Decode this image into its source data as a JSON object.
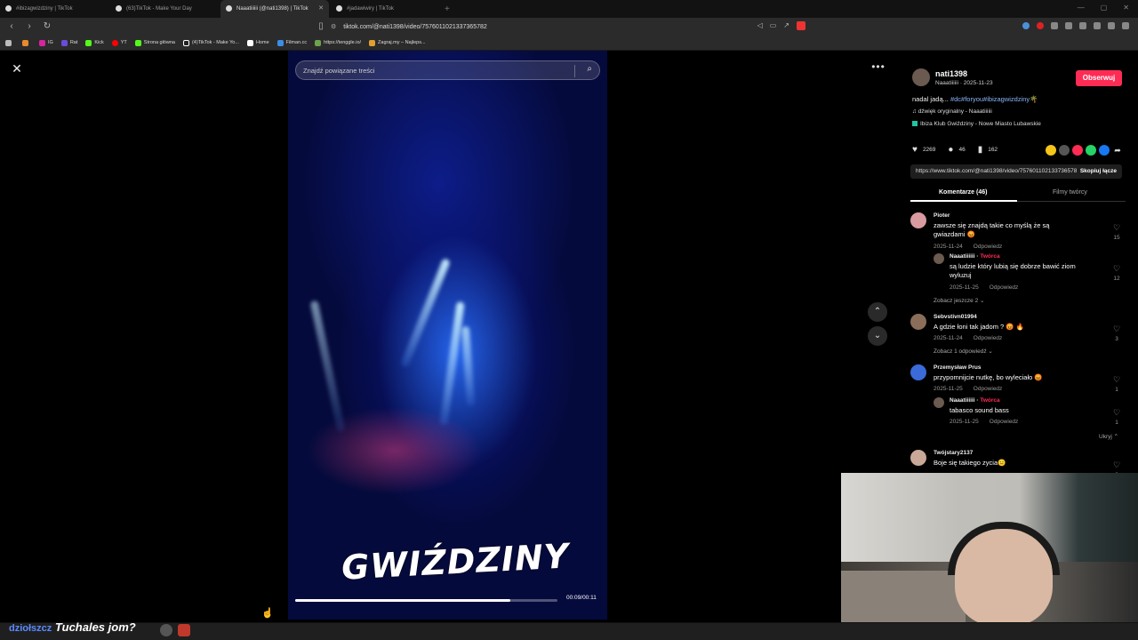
{
  "browser": {
    "tabs": [
      {
        "title": "#ibizagwizdziny | TikTok",
        "active": false
      },
      {
        "title": "(63)TikTok - Make Your Day",
        "active": false
      },
      {
        "title": "Naaatiiiiii (@nati1398) | TikTok",
        "active": true
      },
      {
        "title": "#jadawiwiry | TikTok",
        "active": false
      }
    ],
    "new_tab": "+",
    "url": "tiktok.com/@nati1398/video/7576011021337365782",
    "bookmarks": [
      "IG",
      "Rat",
      "Kick",
      "YT",
      "Strona główna",
      "(4)TikTok - Make Yo...",
      "Home",
      "Filman.cc",
      "https://tenggle.io/",
      "Zagraj.my – Najleps..."
    ]
  },
  "player": {
    "close_label": "✕",
    "more_label": "•••",
    "search_placeholder": "Znajdź powiązane treści",
    "overlay_text": "GWIŹDZINY",
    "time": "00:09/00:11",
    "progress": 0.82,
    "up_label": "⌃",
    "down_label": "⌄"
  },
  "post": {
    "username": "nati1398",
    "subline": "Naaatiiiiii · 2025-11-23",
    "follow_label": "Obserwuj",
    "desc_text": "nadal jadą... ",
    "desc_tags": "#dc#foryou#ibizagwizdziny",
    "desc_emoji": "🌴",
    "music": "dźwięk oryginalny - Naaatiiiiii",
    "location": "Ibiza Klub Gwiździny - Nowe Miasto Lubawskie",
    "likes": "2269",
    "comments_count": "46",
    "saves": "162",
    "link": "https://www.tiktok.com/@nati1398/video/757601102133736578...",
    "copy_label": "Skopiuj łącze",
    "tab_comments": "Komentarze (46)",
    "tab_videos": "Filmy twórcy"
  },
  "comments": [
    {
      "user": "Pioter",
      "text": "zawsze się znajdą takie co myślą że są gwiazdami 😡",
      "date": "2025-11-24",
      "reply": "Odpowiedz",
      "likes": "15"
    },
    {
      "user": "Naaatiiiiii · ",
      "badge": "Twórca",
      "text": "są ludzie który lubią się dobrze bawić ziom wyluzuj",
      "date": "2025-11-25",
      "reply": "Odpowiedz",
      "likes": "12"
    },
    {
      "more": "Zobacz jeszcze 2 ⌄"
    },
    {
      "user": "Sebvstivn01994",
      "text": "A gdzie łoni tak jadom ? 😡 🔥",
      "date": "2025-11-24",
      "reply": "Odpowiedz",
      "likes": "3"
    },
    {
      "more": "Zobacz 1 odpowiedź ⌄"
    },
    {
      "user": "Przemysław Prus",
      "text": "przypomnijcie nutkę, bo wyleciało 😡",
      "date": "2025-11-25",
      "reply": "Odpowiedz",
      "likes": "1"
    },
    {
      "user": "Naaatiiiiii · ",
      "badge": "Twórca",
      "text": "tabasco sound bass",
      "date": "2025-11-25",
      "reply": "Odpowiedz",
      "likes": "1"
    },
    {
      "more": "Ukryj ⌃"
    },
    {
      "user": "Twójstary2137",
      "text": "Boje się takiego zycia😑",
      "likes": "0"
    }
  ],
  "stream_overlay": {
    "prefix": "dziołszcz",
    "text": "Tuchales jom?"
  }
}
